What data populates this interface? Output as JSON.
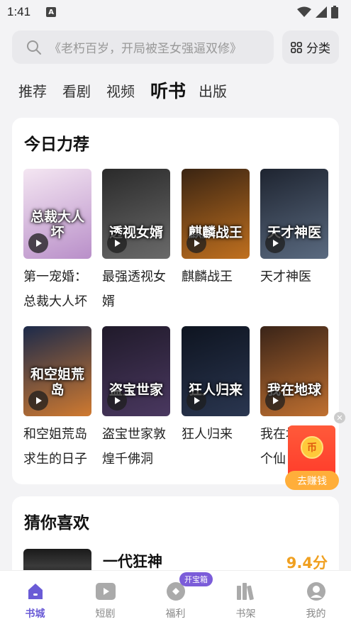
{
  "status_bar": {
    "time": "1:41",
    "notification_letter": "A"
  },
  "search": {
    "placeholder": "《老朽百岁，开局被圣女强逼双修》",
    "category_label": "分类"
  },
  "tabs": [
    {
      "label": "推荐",
      "active": false
    },
    {
      "label": "看剧",
      "active": false
    },
    {
      "label": "视频",
      "active": false
    },
    {
      "label": "听书",
      "active": true
    },
    {
      "label": "出版",
      "active": false
    }
  ],
  "today_picks": {
    "title": "今日力荐",
    "books": [
      {
        "name": "第一宠婚：总裁大人坏",
        "cover_text": "总裁大人坏",
        "colors": [
          "#f4e6f2",
          "#b98fc9"
        ]
      },
      {
        "name": "最强透视女婿",
        "cover_text": "透视女婿",
        "colors": [
          "#2a2a2a",
          "#6a6a6a"
        ]
      },
      {
        "name": "麒麟战王",
        "cover_text": "麒麟战王",
        "colors": [
          "#3a2412",
          "#c0701f"
        ]
      },
      {
        "name": "天才神医",
        "cover_text": "天才神医",
        "colors": [
          "#1e2430",
          "#5a6a80"
        ]
      },
      {
        "name": "和空姐荒岛求生的日子",
        "cover_text": "和空姐荒岛",
        "colors": [
          "#1c2a4a",
          "#d07a30"
        ]
      },
      {
        "name": "盗宝世家敦煌千佛洞",
        "cover_text": "盗宝世家",
        "colors": [
          "#201a2a",
          "#4a3860"
        ]
      },
      {
        "name": "狂人归来",
        "cover_text": "狂人归来",
        "colors": [
          "#0e1420",
          "#2a3650"
        ]
      },
      {
        "name": "我在地球修个仙",
        "cover_text": "我在地球",
        "colors": [
          "#3a2418",
          "#c07030"
        ]
      }
    ]
  },
  "guess": {
    "title": "猜你喜欢",
    "book_name": "一代狂神",
    "score": "9.4分"
  },
  "floating_reward": {
    "label": "去赚钱",
    "coin_char": "币"
  },
  "bottom_nav": [
    {
      "label": "书城",
      "icon": "home-icon",
      "active": true
    },
    {
      "label": "短剧",
      "icon": "play-video-icon",
      "active": false
    },
    {
      "label": "福利",
      "icon": "gift-icon",
      "active": false,
      "badge": "开宝箱"
    },
    {
      "label": "书架",
      "icon": "bookshelf-icon",
      "active": false
    },
    {
      "label": "我的",
      "icon": "profile-icon",
      "active": false
    }
  ],
  "colors": {
    "accent": "#6a5bd6",
    "score": "#f0a020",
    "reward": "#ff4a30"
  }
}
